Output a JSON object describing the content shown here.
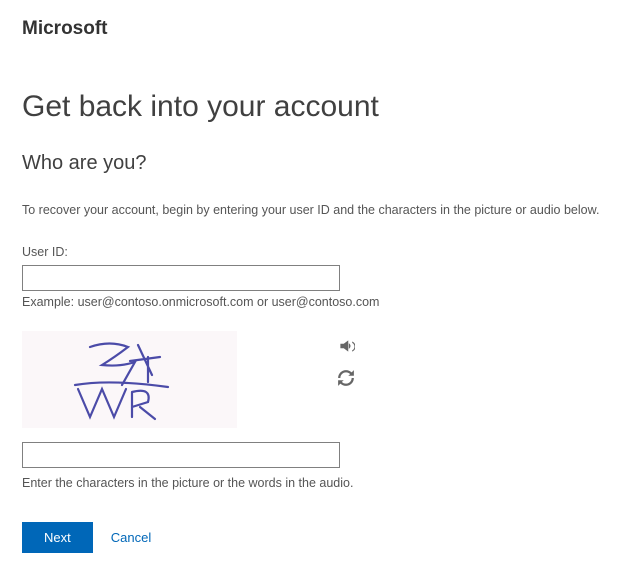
{
  "logo": "Microsoft",
  "heading": "Get back into your account",
  "subheading": "Who are you?",
  "instruction": "To recover your account, begin by entering your user ID and the characters in the picture or audio below.",
  "userid": {
    "label": "User ID:",
    "value": "",
    "example": "Example: user@contoso.onmicrosoft.com or user@contoso.com"
  },
  "captcha": {
    "value": "",
    "hint": "Enter the characters in the picture or the words in the audio.",
    "image_text": "S4WK"
  },
  "buttons": {
    "next": "Next",
    "cancel": "Cancel"
  }
}
